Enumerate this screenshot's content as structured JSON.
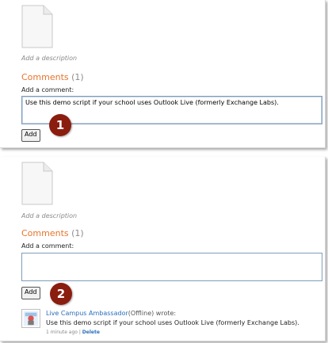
{
  "panel1": {
    "description_placeholder": "Add a description",
    "comments_title": "Comments",
    "comments_count": "(1)",
    "add_comment_label": "Add a comment:",
    "comment_text": "Use this demo script if your school uses Outlook Live (formerly Exchange Labs).",
    "add_button": "Add",
    "step_badge": "1"
  },
  "panel2": {
    "description_placeholder": "Add a description",
    "comments_title": "Comments",
    "comments_count": "(1)",
    "add_comment_label": "Add a comment:",
    "comment_text": "",
    "add_button": "Add",
    "step_badge": "2",
    "comment": {
      "author": "Live Campus Ambassador",
      "status": "(Offline)",
      "wrote": " wrote:",
      "body": "Use this demo script if your school uses Outlook Live (formerly Exchange Labs).",
      "time": "1 minute ago",
      "separator": " | ",
      "delete_label": "Delete"
    }
  },
  "colors": {
    "heading_orange": "#e8742c",
    "badge_red": "#8b1d0f",
    "link_blue": "#2a6ebb"
  }
}
